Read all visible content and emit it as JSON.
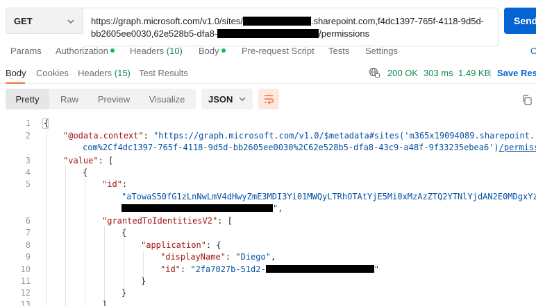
{
  "request": {
    "method": "GET",
    "url_line1_prefix": "https://graph.microsoft.com/v1.0/sites/",
    "url_line1_suffix": ".sharepoint.com,f4dc1397-765f-4118-9d5d-",
    "url_line2_prefix": "bb2605ee0030,62e528b5-dfa8-",
    "url_line2_suffix": "/permissions",
    "send_label": "Send"
  },
  "request_tabs": {
    "params": "Params",
    "authorization": "Authorization",
    "headers": "Headers",
    "headers_count": "(10)",
    "body": "Body",
    "prerequest": "Pre-request Script",
    "tests": "Tests",
    "settings": "Settings",
    "cookies_cut": "C"
  },
  "response": {
    "tabs": {
      "body": "Body",
      "cookies": "Cookies",
      "headers": "Headers",
      "headers_count": "(15)",
      "test_results": "Test Results"
    },
    "status": "200 OK",
    "time": "303 ms",
    "size": "1.49 KB",
    "save_label": "Save Resp",
    "formats": [
      "Pretty",
      "Raw",
      "Preview",
      "Visualize"
    ],
    "active_format": "Pretty",
    "language": "JSON"
  },
  "code": {
    "line_numbers": [
      "1",
      "2",
      "3",
      "4",
      "5",
      "6",
      "7",
      "8",
      "9",
      "10",
      "11",
      "12",
      "13"
    ],
    "l1": "{",
    "l2_key": "\"@odata.context\"",
    "l2_colon": ": ",
    "l2_val": "\"https://graph.microsoft.com/v1.0/$metadata#sites('m365x19094089.sharepoint.",
    "l2b_val": "com%2Cf4dc1397-765f-4118-9d5d-bb2605ee0030%2C62e528b5-dfa8-43c9-a48f-9f33235ebea6')",
    "l2b_link": "/permissio",
    "l3_key": "\"value\"",
    "l3_rest": ": [",
    "l4": "{",
    "l5_key": "\"id\"",
    "l5_rest": ":",
    "l5b_val": "\"aTowaS50fG1zLnNwLmV4dHwyZmE3MDI3Yi01MWQyLTRhOTAtYjE5Mi0xMzAzZTQ2YTNlYjdAN2E0MDgxYzQt",
    "l5c_tail": "\",",
    "l6_key": "\"grantedToIdentitiesV2\"",
    "l6_rest": ": [",
    "l7": "{",
    "l8_key": "\"application\"",
    "l8_rest": ": {",
    "l9_key": "\"displayName\"",
    "l9_colon": ": ",
    "l9_val": "\"Diego\"",
    "l9_comma": ",",
    "l10_key": "\"id\"",
    "l10_colon": ": ",
    "l10_val": "\"2fa7027b-51d2-",
    "l10_tail": "\"",
    "l11": "}",
    "l12": "}",
    "l13": "]"
  },
  "colors": {
    "accent_orange": "#ff6c37",
    "send_blue": "#0265d2",
    "status_green": "#0f8a4b",
    "json_key": "#a31515",
    "json_string": "#0451a5"
  },
  "icons": {
    "method_dropdown": "chevron-down-icon",
    "language_dropdown": "chevron-down-icon",
    "wrap": "wrap-lines-icon",
    "network": "globe-icon",
    "copy": "copy-icon"
  }
}
